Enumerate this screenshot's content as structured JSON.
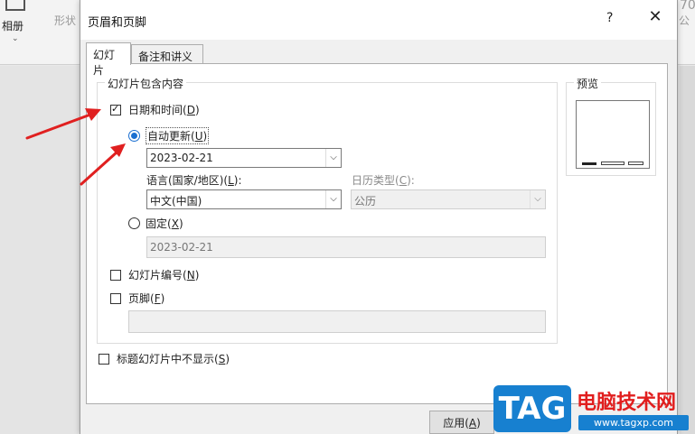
{
  "ribbon": {
    "album_label": "相册",
    "shape_label": "形状",
    "right_partial": "公",
    "top_right_partial": "70"
  },
  "dialog": {
    "title": "页眉和页脚",
    "help_label": "?",
    "close_label": "✕",
    "tabs": [
      "幻灯片",
      "备注和讲义"
    ],
    "group_title": "幻灯片包含内容",
    "preview_title": "预览",
    "date_time_checkbox": {
      "label": "日期和时间",
      "key": "D",
      "checked": true
    },
    "auto_update_radio": {
      "label": "自动更新",
      "key": "U",
      "selected": true
    },
    "auto_date_value": "2023-02-21",
    "language_label": "语言(国家/地区)(",
    "language_key": "L",
    "language_suffix": "):",
    "language_value": "中文(中国)",
    "calendar_label": "日历类型(",
    "calendar_key": "C",
    "calendar_suffix": "):",
    "calendar_value": "公历",
    "fixed_radio": {
      "label": "固定",
      "key": "X",
      "selected": false
    },
    "fixed_date_value": "2023-02-21",
    "slide_number_checkbox": {
      "label": "幻灯片编号",
      "key": "N",
      "checked": false
    },
    "footer_checkbox": {
      "label": "页脚",
      "key": "F",
      "checked": false
    },
    "footer_value": "",
    "hide_title_checkbox": {
      "label": "标题幻灯片中不显示",
      "key": "S",
      "checked": false
    },
    "apply_button": {
      "label": "应用",
      "key": "A"
    }
  },
  "watermark": {
    "badge": "TAG",
    "title": "电脑技术网",
    "url": "www.tagxp.com"
  },
  "colors": {
    "accent": "#1a6fd1",
    "arrow": "#e02020",
    "watermark_blue": "#1780d0",
    "watermark_red": "#e11e1e"
  }
}
